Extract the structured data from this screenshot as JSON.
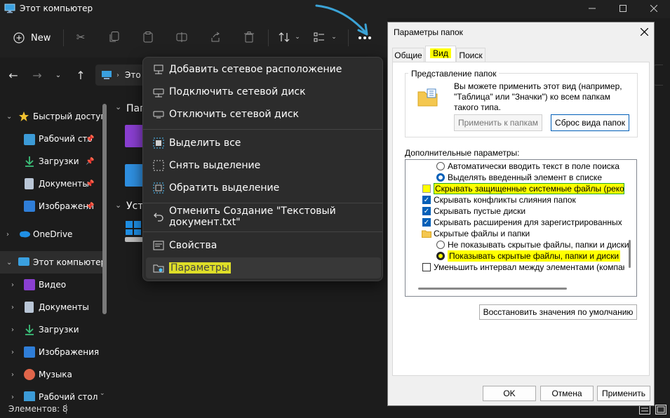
{
  "window": {
    "title": "Этот компьютер"
  },
  "toolbar": {
    "new_label": "New"
  },
  "address": {
    "crumb": "Это"
  },
  "content": {
    "group1_label": "Пап",
    "group2_label": "Уст"
  },
  "sidebar": {
    "items": [
      {
        "label": "Быстрый доступ",
        "icon": "star-icon"
      },
      {
        "label": "Рабочий сто",
        "icon": "desktop-icon"
      },
      {
        "label": "Загрузки",
        "icon": "download-icon"
      },
      {
        "label": "Документы",
        "icon": "document-icon"
      },
      {
        "label": "Изображени",
        "icon": "image-icon"
      },
      {
        "label": "OneDrive",
        "icon": "cloud-icon"
      },
      {
        "label": "Этот компьютер",
        "icon": "computer-icon"
      },
      {
        "label": "Видео",
        "icon": "video-icon"
      },
      {
        "label": "Документы",
        "icon": "document-icon"
      },
      {
        "label": "Загрузки",
        "icon": "download-icon"
      },
      {
        "label": "Изображения",
        "icon": "image-icon"
      },
      {
        "label": "Музыка",
        "icon": "music-icon"
      },
      {
        "label": "Рабочий стол",
        "icon": "desktop-icon"
      }
    ]
  },
  "status": {
    "items_count": "Элементов: 8"
  },
  "menu": {
    "items": [
      {
        "label": "Добавить сетевое расположение",
        "icon": "network-location-icon"
      },
      {
        "label": "Подключить сетевой диск",
        "icon": "map-drive-icon"
      },
      {
        "label": "Отключить сетевой диск",
        "icon": "disconnect-drive-icon"
      },
      {
        "label": "Выделить все",
        "icon": "select-all-icon"
      },
      {
        "label": "Снять выделение",
        "icon": "select-none-icon"
      },
      {
        "label": "Обратить выделение",
        "icon": "invert-selection-icon"
      },
      {
        "label": "Отменить Создание \"Текстовый документ.txt\"",
        "icon": "undo-icon"
      },
      {
        "label": "Свойства",
        "icon": "properties-icon"
      },
      {
        "label": "Параметры",
        "icon": "options-icon"
      }
    ]
  },
  "dialog": {
    "title": "Параметры папок",
    "tabs": [
      "Общие",
      "Вид",
      "Поиск"
    ],
    "folder_views": {
      "legend": "Представление папок",
      "text_line1": "Вы можете применить этот вид (например,",
      "text_line2": "\"Таблица\" или \"Значки\") ко всем папкам",
      "text_line3": "такого типа.",
      "apply_label": "Применить к папкам",
      "reset_label": "Сброс вида папок"
    },
    "advanced_label": "Дополнительные параметры:",
    "options": [
      {
        "label": "Автоматически вводить текст в поле поиска",
        "type": "radio",
        "checked": false
      },
      {
        "label": "Выделять введенный элемент в списке",
        "type": "radio",
        "checked": true
      },
      {
        "label": "Скрывать защищенные системные файлы (рекомен",
        "type": "checkbox",
        "checked": false
      },
      {
        "label": "Скрывать конфликты слияния папок",
        "type": "checkbox",
        "checked": true
      },
      {
        "label": "Скрывать пустые диски",
        "type": "checkbox",
        "checked": true
      },
      {
        "label": "Скрывать расширения для зарегистрированных типо",
        "type": "checkbox",
        "checked": true
      },
      {
        "label": "Скрытые файлы и папки",
        "type": "folder",
        "checked": false
      },
      {
        "label": "Не показывать скрытые файлы, папки и диски",
        "type": "radio",
        "checked": false
      },
      {
        "label": "Показывать скрытые файлы, папки и диски",
        "type": "radio",
        "checked": true
      },
      {
        "label": "Уменьшить интервал между элементами (компактны",
        "type": "checkbox",
        "checked": false
      }
    ],
    "restore_label": "Восстановить значения по умолчанию",
    "ok_label": "OK",
    "cancel_label": "Отмена",
    "apply_label": "Применить"
  },
  "colors": {
    "accent": "#005fb8",
    "highlight": "#ffff00",
    "arrow": "#3ba3d6"
  }
}
